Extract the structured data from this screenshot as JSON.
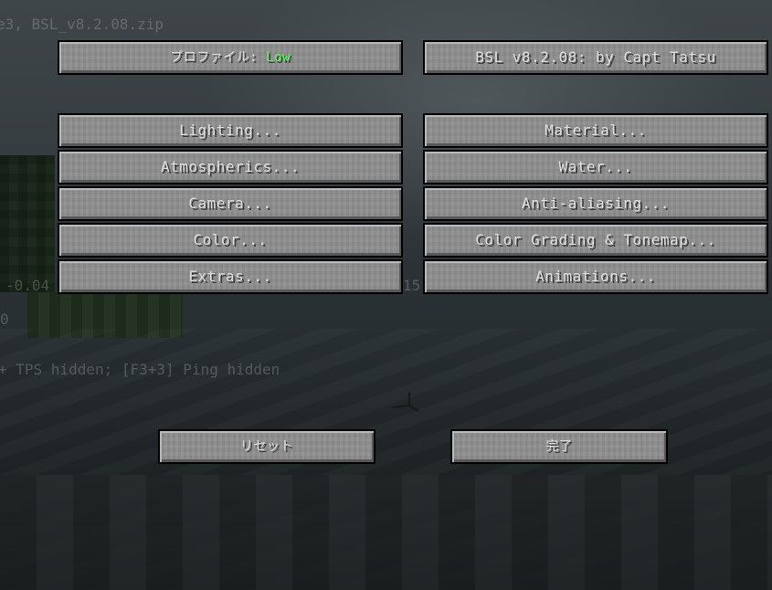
{
  "debug": {
    "line1": "e3, BSL_v8.2.08.zip",
    "line2": "-0.04",
    "line2b": "15",
    "line3": "0",
    "line4": "+ TPS hidden; [F3+3] Ping hidden"
  },
  "header": {
    "profile_label": "プロファイル: ",
    "profile_value": "Low",
    "shader_title": "BSL v8.2.08: by Capt Tatsu"
  },
  "options": {
    "left": [
      {
        "label": "Lighting..."
      },
      {
        "label": "Atmospherics..."
      },
      {
        "label": "Camera..."
      },
      {
        "label": "Color..."
      },
      {
        "label": "Extras..."
      }
    ],
    "right": [
      {
        "label": "Material..."
      },
      {
        "label": "Water..."
      },
      {
        "label": "Anti-aliasing..."
      },
      {
        "label": "Color Grading & Tonemap..."
      },
      {
        "label": "Animations..."
      }
    ]
  },
  "footer": {
    "reset_label": "リセット",
    "done_label": "完了"
  },
  "colors": {
    "profile_value": "#55ff55",
    "button_face": "#8f8f8f",
    "button_text": "#e0e0e0"
  }
}
